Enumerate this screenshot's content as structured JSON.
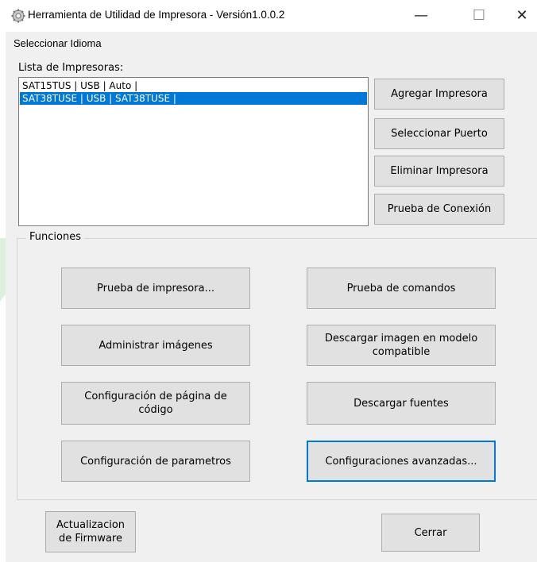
{
  "window": {
    "title": "Herramienta de Utilidad de Impresora - Versión1.0.0.2",
    "minimize": "—",
    "maximize": "☐",
    "close": "✕"
  },
  "menu": {
    "items": [
      "Seleccionar Idioma"
    ]
  },
  "printers": {
    "label": "Lista de Impresoras:",
    "items": [
      {
        "text": "SAT15TUS | USB | Auto |",
        "selected": false
      },
      {
        "text": "SAT38TUSE | USB | SAT38TUSE |",
        "selected": true
      }
    ],
    "buttons": {
      "add": "Agregar Impresora",
      "select_port": "Seleccionar Puerto",
      "remove": "Eliminar Impresora",
      "test_connection": "Prueba de Conexión"
    }
  },
  "functions": {
    "title": "Funciones",
    "buttons": {
      "print_test": "Prueba de impresora...",
      "command_test": "Prueba de comandos",
      "manage_images": "Administrar imágenes",
      "download_image": "Descargar imagen en modelo compatible",
      "codepage_config": "Configuración de página de código",
      "download_fonts": "Descargar fuentes",
      "parameter_config": "Configuración de parametros",
      "advanced_config": "Configuraciones avanzadas..."
    }
  },
  "footer": {
    "firmware": "Actualizacion de Firmware",
    "close": "Cerrar"
  },
  "colors": {
    "selection": "#0078d7",
    "watermark": "#d6ecd6"
  }
}
